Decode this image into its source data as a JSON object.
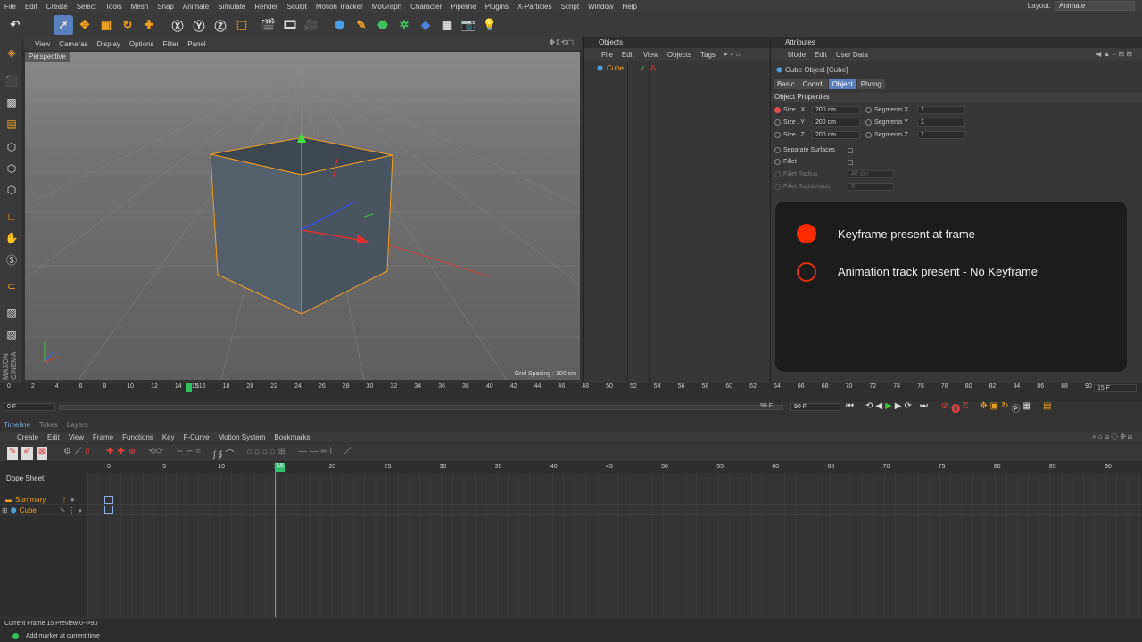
{
  "menu": {
    "items": [
      "File",
      "Edit",
      "Create",
      "Select",
      "Tools",
      "Mesh",
      "Snap",
      "Animate",
      "Simulate",
      "Render",
      "Sculpt",
      "Motion Tracker",
      "MoGraph",
      "Character",
      "Pipeline",
      "Plugins",
      "X-Particles",
      "Script",
      "Window",
      "Help"
    ],
    "layout_label": "Layout:",
    "layout_value": "Animate"
  },
  "viewport": {
    "menu": [
      "View",
      "Cameras",
      "Display",
      "Options",
      "Filter",
      "Panel"
    ],
    "label": "Perspective",
    "grid_spacing": "Grid Spacing : 100 cm"
  },
  "objects": {
    "title": "Objects",
    "menu": [
      "File",
      "Edit",
      "View",
      "Objects",
      "Tags"
    ],
    "item": "Cube"
  },
  "attributes": {
    "title": "Attributes",
    "menu": [
      "Mode",
      "Edit",
      "User Data"
    ],
    "object_name": "Cube Object [Cube]",
    "tabs": [
      "Basic",
      "Coord.",
      "Object",
      "Phong"
    ],
    "active_tab": "Object",
    "section": "Object Properties",
    "size_rows": [
      {
        "label": "Size . X",
        "value": "200 cm",
        "seg_label": "Segments X",
        "seg_value": "1"
      },
      {
        "label": "Size . Y",
        "value": "200 cm",
        "seg_label": "Segments Y",
        "seg_value": "1"
      },
      {
        "label": "Size . Z",
        "value": "200 cm",
        "seg_label": "Segments Z",
        "seg_value": "1"
      }
    ],
    "separate_surfaces": "Separate Surfaces",
    "fillet": "Fillet",
    "fillet_radius": "Fillet Radius",
    "fillet_radius_value": "40 cm",
    "fillet_subdivision": "Fillet Subdivision",
    "fillet_subdivision_value": "5"
  },
  "legend": {
    "keyframe": "Keyframe present at frame",
    "track": "Animation track present - No Keyframe",
    "colors": {
      "filled": "#ff2a00",
      "ring": "#e03010"
    }
  },
  "ruler": {
    "ticks": [
      "0",
      "2",
      "4",
      "6",
      "8",
      "10",
      "12",
      "14",
      "16",
      "18",
      "20",
      "22",
      "24",
      "26",
      "28",
      "30",
      "32",
      "34",
      "36",
      "38",
      "40",
      "42",
      "44",
      "46",
      "48",
      "50",
      "52",
      "54",
      "56",
      "58",
      "60",
      "62",
      "64",
      "66",
      "68",
      "70",
      "72",
      "74",
      "76",
      "78",
      "80",
      "82",
      "84",
      "86",
      "88",
      "90"
    ],
    "current": "15",
    "end_label": "15 F"
  },
  "frames": {
    "start": "0 F",
    "end_left": "90 F",
    "end_right": "90 F"
  },
  "bottom_tabs": [
    "Timeline",
    "Takes",
    "Layers"
  ],
  "timeline": {
    "menu": [
      "Create",
      "Edit",
      "View",
      "Frame",
      "Functions",
      "Key",
      "F-Curve",
      "Motion System",
      "Bookmarks"
    ],
    "dope_sheet": "Dope Sheet",
    "tracks": [
      "Summary",
      "Cube"
    ],
    "ticks": [
      "0",
      "5",
      "10",
      "15",
      "20",
      "25",
      "30",
      "35",
      "40",
      "45",
      "50",
      "55",
      "60",
      "65",
      "70",
      "75",
      "80",
      "85",
      "90"
    ],
    "current": "15"
  },
  "status": {
    "line1": "Current Frame  15  Preview  0-->90",
    "line2": "Add marker at current time"
  }
}
